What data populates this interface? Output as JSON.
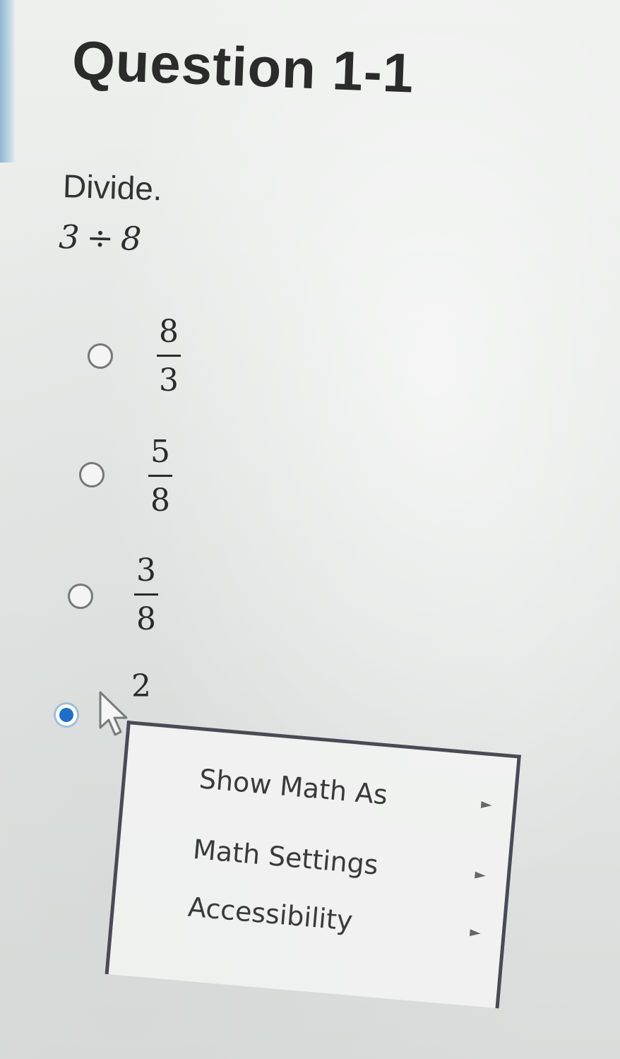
{
  "question": {
    "title": "Question 1-1",
    "instruction": "Divide.",
    "expression": {
      "left": "3",
      "operator": "÷",
      "right": "8"
    }
  },
  "options": [
    {
      "numerator": "8",
      "denominator": "3",
      "selected": false
    },
    {
      "numerator": "5",
      "denominator": "8",
      "selected": false
    },
    {
      "numerator": "3",
      "denominator": "8",
      "selected": false
    },
    {
      "value": "2",
      "selected": true
    }
  ],
  "context_menu": {
    "items": [
      {
        "label": "Show Math As",
        "arrow_icon": "chevron-right-icon"
      },
      {
        "label": "Math Settings",
        "arrow_icon": "chevron-right-icon"
      },
      {
        "label": "Accessibility",
        "arrow_icon": "chevron-right-icon"
      }
    ]
  },
  "colors": {
    "selected_radio": "#1f6fc9",
    "menu_border": "#4a4a55"
  }
}
